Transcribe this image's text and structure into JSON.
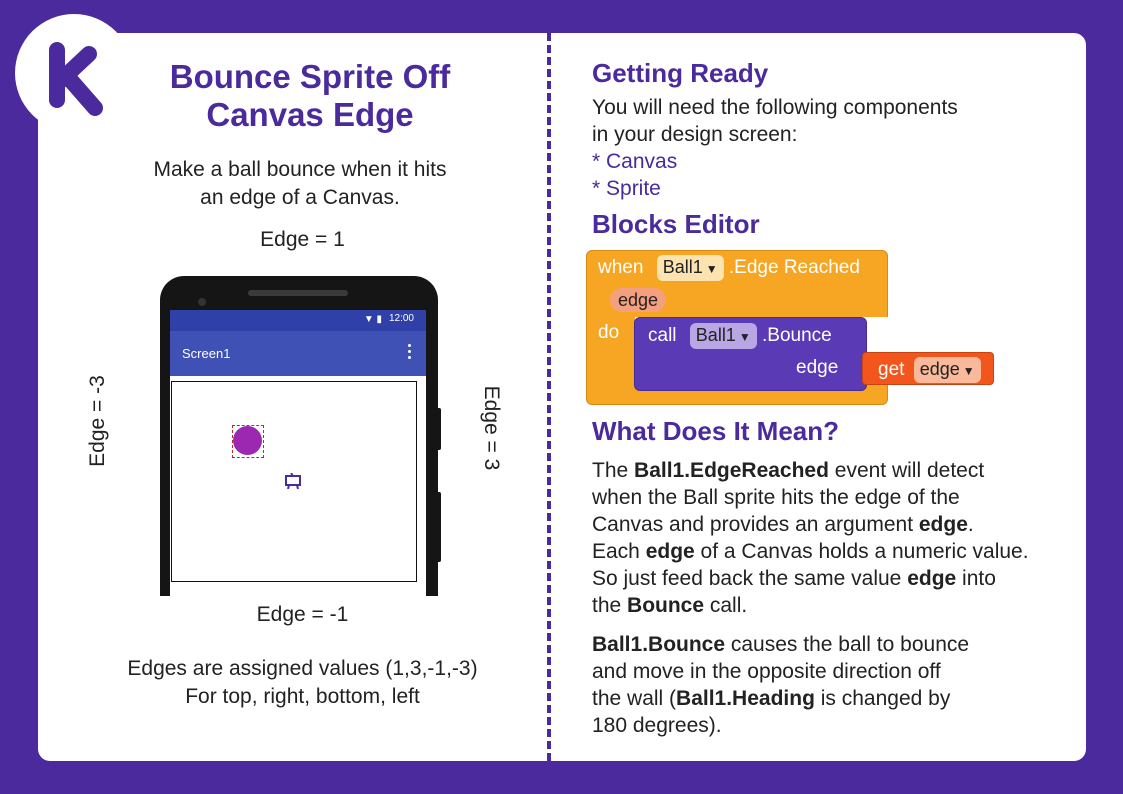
{
  "brand": {
    "logo_letter": "k",
    "bg_color": "#4a2a9c"
  },
  "left": {
    "title_line1": "Bounce Sprite Off",
    "title_line2": "Canvas Edge",
    "subtitle_line1": "Make a ball bounce when it hits",
    "subtitle_line2": "an edge of a Canvas.",
    "edge_top": "Edge = 1",
    "edge_right": "Edge = 3",
    "edge_bottom": "Edge = -1",
    "edge_left": "Edge = -3",
    "caption_line1": "Edges are assigned values (1,3,-1,-3)",
    "caption_line2": "For top, right, bottom, left",
    "phone": {
      "time": "12:00",
      "screen_title": "Screen1"
    }
  },
  "right": {
    "getting_ready": {
      "heading": "Getting Ready",
      "line1": "You will need the following components",
      "line2": "in your design screen:",
      "items": [
        "* Canvas",
        "* Sprite"
      ]
    },
    "blocks_editor": {
      "heading": "Blocks Editor",
      "when": "when",
      "component": "Ball1",
      "event": ".Edge Reached",
      "param": "edge",
      "do": "do",
      "call": "call",
      "call_component": "Ball1",
      "method": ".Bounce",
      "arg_name": "edge",
      "get": "get",
      "get_var": "edge"
    },
    "meaning": {
      "heading": "What Does It Mean?",
      "p1": [
        {
          "t": "The ",
          "b": false
        },
        {
          "t": "Ball1.EdgeReached",
          "b": true
        },
        {
          "t": " event will detect",
          "b": false
        },
        {
          "t": "when the Ball sprite hits the edge of the",
          "b": false,
          "br": true
        },
        {
          "t": "Canvas and provides an argument ",
          "b": false,
          "br": true
        },
        {
          "t": "edge",
          "b": true
        },
        {
          "t": ".",
          "b": false
        },
        {
          "t": "Each ",
          "b": false,
          "br": true
        },
        {
          "t": "edge",
          "b": true
        },
        {
          "t": " of a Canvas holds a numeric value.",
          "b": false
        },
        {
          "t": "So just feed back the same value ",
          "b": false,
          "br": true
        },
        {
          "t": "edge",
          "b": true
        },
        {
          "t": " into",
          "b": false
        },
        {
          "t": "the ",
          "b": false,
          "br": true
        },
        {
          "t": "Bounce",
          "b": true
        },
        {
          "t": " call.",
          "b": false
        }
      ],
      "p2": [
        {
          "t": "Ball1.Bounce",
          "b": true
        },
        {
          "t": " causes the ball to bounce",
          "b": false
        },
        {
          "t": "and move in the opposite direction off",
          "b": false,
          "br": true
        },
        {
          "t": "the wall (",
          "b": false,
          "br": true
        },
        {
          "t": "Ball1.Heading",
          "b": true
        },
        {
          "t": " is changed by",
          "b": false
        },
        {
          "t": "180 degrees).",
          "b": false,
          "br": true
        }
      ]
    }
  }
}
